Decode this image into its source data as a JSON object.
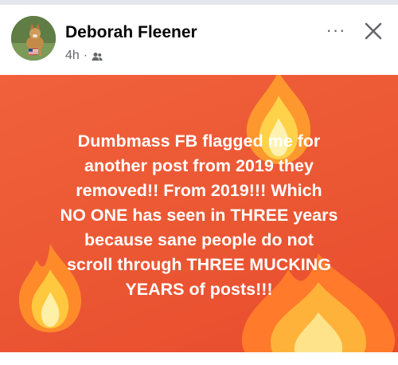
{
  "post": {
    "author": "Deborah Fleener",
    "time": "4h",
    "separator": "·",
    "audience_icon": "friends-icon",
    "more_icon": "more-icon",
    "more_label": "···",
    "close_icon": "close-icon",
    "body_text": "Dumbmass FB flagged me for\nanother post from 2019 they\nremoved!!  From 2019!!!  Which\nNO ONE has seen in THREE years\nbecause sane people do not\nscroll through THREE MUCKING\nYEARS of posts!!!",
    "background_color": "#ec5a35",
    "background_decoration": "flame-emoji"
  }
}
